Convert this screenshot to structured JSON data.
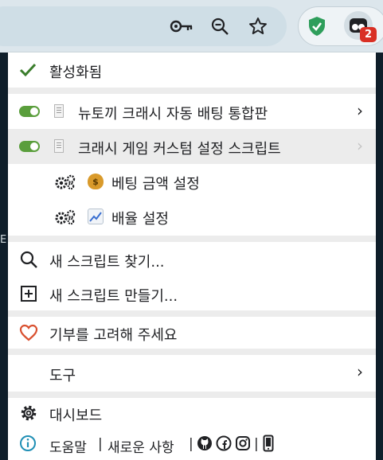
{
  "menu": {
    "enabled_label": "활성화됨",
    "scripts": [
      {
        "name": "뉴토끼 크래시 자동 배팅 통합판",
        "enabled": true
      },
      {
        "name": "크래시 게임 커스텀 설정 스크립트",
        "enabled": true
      }
    ],
    "commands": [
      {
        "emoji": "money-bag-icon",
        "label": "베팅 금액 설정"
      },
      {
        "emoji": "chart-increasing-icon",
        "label": "배율 설정"
      }
    ],
    "find_script": "새 스크립트 찾기...",
    "create_script": "새 스크립트 만들기...",
    "donate": "기부를 고려해 주세요",
    "tools": "도구",
    "dashboard": "대시보드",
    "help_line": {
      "help": "도움말",
      "sep1": "|",
      "whats_new": "새로운 사항",
      "sep2": "|",
      "sep3": "|"
    }
  },
  "toolbar": {
    "extension_badge": "2"
  },
  "page": {
    "edge_letter": "E"
  },
  "colors": {
    "check": "#3a7d2c",
    "toggle_on": "#5a9e3c",
    "heart": "#d9502f",
    "info": "#1f8fb5",
    "shield": "#2e9e5b",
    "badge": "#d93025"
  }
}
